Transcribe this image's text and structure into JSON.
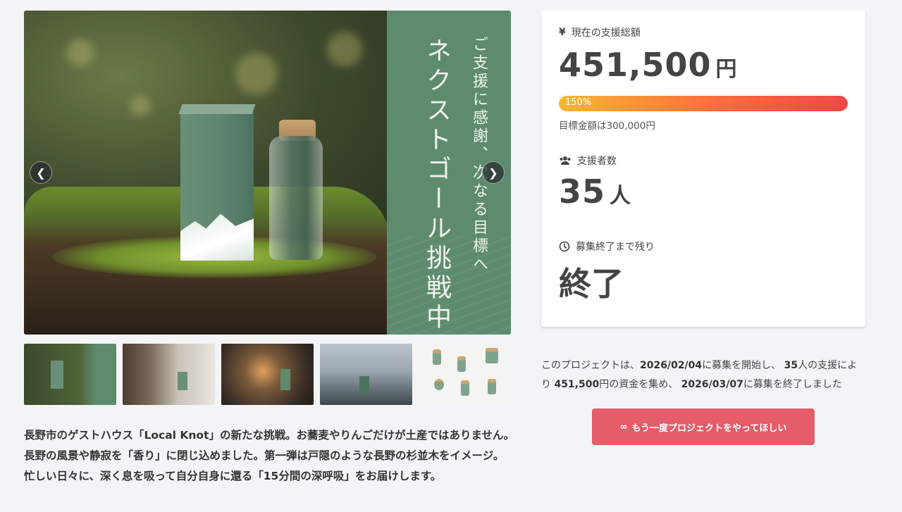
{
  "hero": {
    "panel_text_1": "ご支援に感謝、次なる目標へ",
    "panel_text_2": "ネクストゴール挑戦中",
    "prev_icon": "chevron-left-icon",
    "next_icon": "chevron-right-icon"
  },
  "description": "長野市のゲストハウス「Local Knot」の新たな挑戦。お蕎麦やりんごだけが土産ではありません。 長野の風景や静寂を「香り」に閉じ込めました。第一弾は戸隠のような長野の杉並木をイメージ。 忙しい日々に、深く息を吸って自分自身に還る「15分間の深呼吸」をお届けします。",
  "stats": {
    "funding_label": "現在の支援総額",
    "funding_amount": "451,500",
    "funding_unit": "円",
    "progress_label": "150%",
    "progress_percent": 150,
    "goal_text": "目標金額は300,000円",
    "backers_label": "支援者数",
    "backers_count": "35",
    "backers_unit": "人",
    "remaining_label": "募集終了まで残り",
    "remaining_value": "終了"
  },
  "summary": {
    "p1": "このプロジェクトは、",
    "start_date": "2026/02/04",
    "p2": "に募集を開始し、",
    "backers": "35",
    "p3": "人の支援により",
    "amount": "451,500",
    "p4": "円の資金を集め、",
    "end_date": "2026/03/07",
    "p5": "に募集を終了しました"
  },
  "cta_label": "もう一度プロジェクトをやってほしい",
  "colors": {
    "accent": "#e35d6a",
    "progress_start": "#f7b733",
    "progress_end": "#f04848",
    "panel_green": "#5e8b6e"
  }
}
